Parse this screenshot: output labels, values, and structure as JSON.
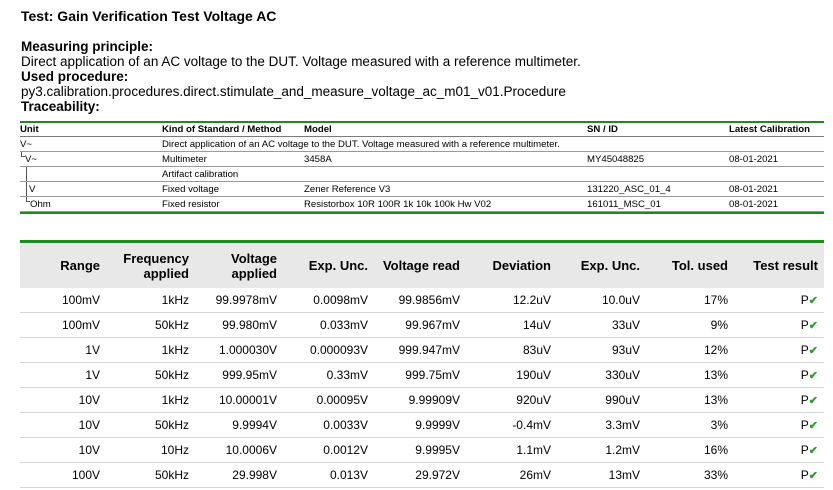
{
  "title": "Test: Gain Verification Test Voltage AC",
  "measuring_principle_label": "Measuring principle:",
  "measuring_principle_text": "Direct application of an AC voltage to the DUT. Voltage measured with a reference multimeter.",
  "used_procedure_label": "Used procedure:",
  "used_procedure_text": "py3.calibration.procedures.direct.stimulate_and_measure_voltage_ac_m01_v01.Procedure",
  "traceability_label": "Traceability:",
  "traceability": {
    "headers": [
      "Unit",
      "Kind of Standard / Method",
      "Model",
      "SN / ID",
      "Latest Calibration"
    ],
    "rows": [
      {
        "unit": "V~",
        "kind": "Direct application of an AC voltage to the DUT. Voltage measured with a reference multimeter.",
        "model": "",
        "sn": "",
        "cal": ""
      },
      {
        "unit": "V~",
        "kind": "Multimeter",
        "model": "3458A",
        "sn": "MY45048825",
        "cal": "08-01-2021"
      },
      {
        "unit": "",
        "kind": "Artifact calibration",
        "model": "",
        "sn": "",
        "cal": ""
      },
      {
        "unit": "V",
        "kind": "Fixed voltage",
        "model": "Zener Reference V3",
        "sn": "131220_ASC_01_4",
        "cal": "08-01-2021"
      },
      {
        "unit": "Ohm",
        "kind": "Fixed resistor",
        "model": "Resistorbox 10R 100R 1k 10k 100k Hw V02",
        "sn": "161011_MSC_01",
        "cal": "08-01-2021"
      }
    ]
  },
  "results": {
    "headers": [
      "Range",
      "Frequency applied",
      "Voltage applied",
      "Exp. Unc.",
      "Voltage read",
      "Deviation",
      "Exp. Unc.",
      "Tol. used",
      "Test result"
    ],
    "rows": [
      {
        "range": "100mV",
        "freq": "1kHz",
        "vapp": "99.9978mV",
        "unc1": "0.0098mV",
        "vread": "99.9856mV",
        "dev": "12.2uV",
        "unc2": "10.0uV",
        "tol": "17%",
        "result": "P"
      },
      {
        "range": "100mV",
        "freq": "50kHz",
        "vapp": "99.980mV",
        "unc1": "0.033mV",
        "vread": "99.967mV",
        "dev": "14uV",
        "unc2": "33uV",
        "tol": "9%",
        "result": "P"
      },
      {
        "range": "1V",
        "freq": "1kHz",
        "vapp": "1.000030V",
        "unc1": "0.000093V",
        "vread": "999.947mV",
        "dev": "83uV",
        "unc2": "93uV",
        "tol": "12%",
        "result": "P"
      },
      {
        "range": "1V",
        "freq": "50kHz",
        "vapp": "999.95mV",
        "unc1": "0.33mV",
        "vread": "999.75mV",
        "dev": "190uV",
        "unc2": "330uV",
        "tol": "13%",
        "result": "P"
      },
      {
        "range": "10V",
        "freq": "1kHz",
        "vapp": "10.00001V",
        "unc1": "0.00095V",
        "vread": "9.99909V",
        "dev": "920uV",
        "unc2": "990uV",
        "tol": "13%",
        "result": "P"
      },
      {
        "range": "10V",
        "freq": "50kHz",
        "vapp": "9.9994V",
        "unc1": "0.0033V",
        "vread": "9.9999V",
        "dev": "-0.4mV",
        "unc2": "3.3mV",
        "tol": "3%",
        "result": "P"
      },
      {
        "range": "10V",
        "freq": "10Hz",
        "vapp": "10.0006V",
        "unc1": "0.0012V",
        "vread": "9.9995V",
        "dev": "1.1mV",
        "unc2": "1.2mV",
        "tol": "16%",
        "result": "P"
      },
      {
        "range": "100V",
        "freq": "50kHz",
        "vapp": "29.998V",
        "unc1": "0.013V",
        "vread": "29.972V",
        "dev": "26mV",
        "unc2": "13mV",
        "tol": "33%",
        "result": "P"
      }
    ]
  }
}
